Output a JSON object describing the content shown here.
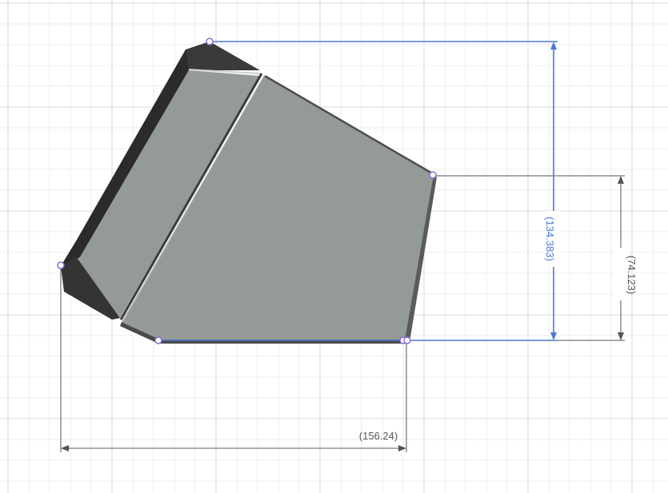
{
  "dimensions": {
    "vertical_blue": {
      "label": "(134.383)",
      "color": "#4a78d6"
    },
    "vertical_gray": {
      "label": "(74.123)",
      "color": "#555555"
    },
    "horizontal_gray": {
      "label": "(156.24)",
      "color": "#555555"
    }
  },
  "colors": {
    "background": "#ffffff",
    "grid_minor": "#ececec",
    "grid_major": "#d9d9d9",
    "part_fill": "#8e9690",
    "part_edge": "#3c3c3c",
    "part_dark": "#2b2b2b",
    "sketch_line": "#4a78d6",
    "point_marker": "#8a6bd8"
  }
}
